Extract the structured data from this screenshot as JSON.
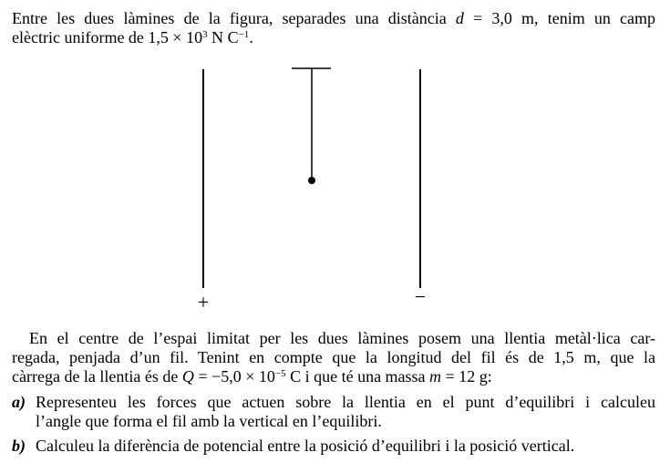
{
  "intro": {
    "line1": "Entre les dues làmines de la figura, separades una distància ",
    "d_var": "d",
    "d_val": " = 3,0 m, tenim un camp",
    "line2_pre": "elèctric uniforme de 1,5 × 10",
    "e_exp": "3",
    "line2_mid": " N C",
    "e_unit_exp": "−1",
    "line2_end": "."
  },
  "figure": {
    "plus_sign": "+",
    "minus_sign": "−"
  },
  "body": {
    "line1": "En el centre de l’espai limitat per les dues làmines posem una llentia metàl·lica car-",
    "line2": "regada, penjada d’un fil. Tenint en compte que la longitud del fil és de 1,5 m, que la",
    "line3_pre": "càrrega de la llentia és de ",
    "q_var": "Q",
    "q_val": " = −5,0 × 10",
    "q_exp": "−5",
    "q_unit": " C i que té una massa ",
    "m_var": "m",
    "m_val": " = 12 g:"
  },
  "items": [
    {
      "label": "a)",
      "line1": "Representeu les forces que actuen sobre la llentia en el punt d’equilibri i calculeu",
      "line2": "l’angle que forma el fil amb la vertical en l’equilibri."
    },
    {
      "label": "b)",
      "line1": "Calculeu la diferència de potencial entre la posició d’equilibri i la posició vertical."
    }
  ]
}
